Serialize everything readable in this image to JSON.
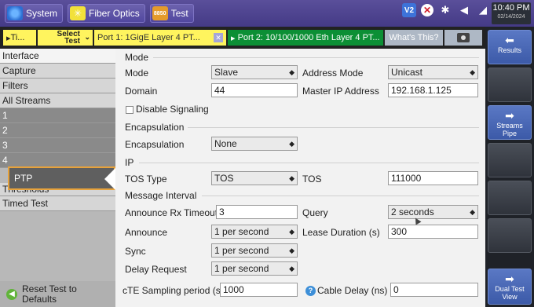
{
  "topbar": {
    "system_label": "System",
    "fiber_label": "Fiber Optics",
    "test_label": "Test",
    "test_icon_text": "8850",
    "status_v2": "V2",
    "clock_time": "10:40 PM",
    "clock_date": "02/14/2024"
  },
  "tabs": {
    "t1": "Ti...",
    "select_line1": "Select",
    "select_line2": "Test",
    "port1": "Port 1: 1GigE Layer 4 PT...",
    "port2": "Port 2: 10/100/1000 Eth Layer 4 PT...",
    "whats_this": "What's This?"
  },
  "nav": {
    "items": [
      "Interface",
      "Capture",
      "Filters",
      "All Streams",
      "1",
      "2",
      "3",
      "4",
      "PTP",
      "Thresholds",
      "Timed Test"
    ],
    "reset_line1": "Reset Test to",
    "reset_line2": "Defaults"
  },
  "mode": {
    "title": "Mode",
    "mode_label": "Mode",
    "mode_value": "Slave",
    "address_mode_label": "Address Mode",
    "address_mode_value": "Unicast",
    "domain_label": "Domain",
    "domain_value": "44",
    "master_ip_label": "Master IP Address",
    "master_ip_value": "192.168.1.125",
    "disable_signaling_label": "Disable Signaling"
  },
  "encapsulation": {
    "title": "Encapsulation",
    "label": "Encapsulation",
    "value": "None"
  },
  "ip": {
    "title": "IP",
    "tos_type_label": "TOS Type",
    "tos_type_value": "TOS",
    "tos_label": "TOS",
    "tos_value": "111000"
  },
  "message_interval": {
    "title": "Message Interval",
    "announce_rx_label": "Announce Rx Timeout",
    "announce_rx_value": "3",
    "query_label": "Query",
    "query_value": "2 seconds",
    "announce_label": "Announce",
    "announce_value": "1 per second",
    "lease_label": "Lease Duration (s)",
    "lease_value": "300",
    "sync_label": "Sync",
    "sync_value": "1 per second",
    "delay_label": "Delay Request",
    "delay_value": "1 per second"
  },
  "bottom": {
    "cte_label": "cTE Sampling period (s)",
    "cte_value": "1000",
    "cable_label": "Cable Delay (ns)",
    "cable_value": "0"
  },
  "rightbar": {
    "results": "Results",
    "streams_pipe_1": "Streams",
    "streams_pipe_2": "Pipe",
    "dual_1": "Dual Test",
    "dual_2": "View"
  }
}
